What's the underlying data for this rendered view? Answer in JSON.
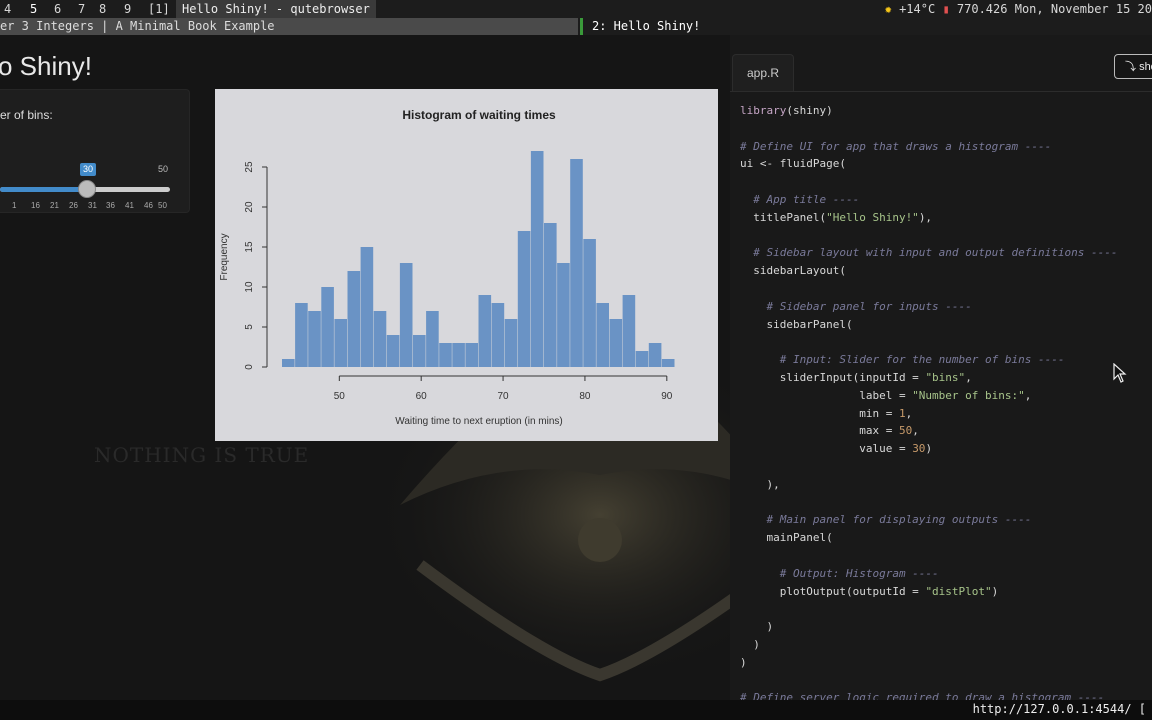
{
  "topbar": {
    "workspaces": [
      {
        "label": "4",
        "sup": "",
        "x": 4
      },
      {
        "label": "5",
        "sup": "",
        "x": 30,
        "active": true
      },
      {
        "label": "6",
        "sup": "",
        "x": 54
      },
      {
        "label": "7",
        "sup": "",
        "x": 78
      },
      {
        "label": "8",
        "sup": "",
        "x": 99
      },
      {
        "label": "9",
        "sup": "",
        "x": 124
      }
    ],
    "layout_indicator": "[1]",
    "window_title": "Hello Shiny! - qutebrowser",
    "weather": "+14°C",
    "battery": "770.426",
    "datetime": "Mon, November 15 20"
  },
  "tabs": {
    "tab1": "er 3 Integers | A Minimal Book Example",
    "tab2": "2: Hello Shiny!"
  },
  "app": {
    "title": "o Shiny!",
    "slider": {
      "label": "er of bins:",
      "value": "30",
      "max_label": "50",
      "ticks": [
        "1",
        "16",
        "21",
        "26",
        "31",
        "36",
        "41",
        "46",
        "50"
      ]
    },
    "watermark": "NOTHING IS TRUE"
  },
  "plot": {
    "title": "Histogram of waiting times",
    "xlabel": "Waiting time to next eruption (in mins)",
    "ylabel": "Frequency"
  },
  "chart_data": {
    "type": "bar",
    "title": "Histogram of waiting times",
    "xlabel": "Waiting time to next eruption (in mins)",
    "ylabel": "Frequency",
    "bin_width": 1.6,
    "x_start": 43,
    "values": [
      1,
      8,
      7,
      10,
      6,
      12,
      15,
      7,
      4,
      13,
      4,
      7,
      3,
      3,
      3,
      9,
      8,
      6,
      17,
      27,
      18,
      13,
      26,
      16,
      8,
      6,
      9,
      2,
      3,
      1
    ],
    "xticks": [
      50,
      60,
      70,
      80,
      90
    ],
    "yticks": [
      0,
      5,
      10,
      15,
      20,
      25
    ],
    "xlim": [
      43,
      91
    ],
    "ylim": [
      0,
      27
    ],
    "bar_color": "#6a93c5"
  },
  "code_panel": {
    "tab_label": "app.R",
    "show_button": "show",
    "lines": [
      [
        [
          "fn",
          "library"
        ],
        [
          "",
          "("
        ],
        [
          "",
          "shiny"
        ],
        [
          "",
          ")"
        ]
      ],
      [],
      [
        [
          "cm",
          "# Define UI for app that draws a histogram ----"
        ]
      ],
      [
        [
          "",
          "ui <- fluidPage("
        ]
      ],
      [],
      [
        [
          "cm",
          "  # App title ----"
        ]
      ],
      [
        [
          "",
          "  titlePanel("
        ],
        [
          "st",
          "\"Hello Shiny!\""
        ],
        [
          "",
          "),"
        ]
      ],
      [],
      [
        [
          "cm",
          "  # Sidebar layout with input and output definitions ----"
        ]
      ],
      [
        [
          "",
          "  sidebarLayout("
        ]
      ],
      [],
      [
        [
          "cm",
          "    # Sidebar panel for inputs ----"
        ]
      ],
      [
        [
          "",
          "    sidebarPanel("
        ]
      ],
      [],
      [
        [
          "cm",
          "      # Input: Slider for the number of bins ----"
        ]
      ],
      [
        [
          "",
          "      sliderInput(inputId = "
        ],
        [
          "st",
          "\"bins\""
        ],
        [
          "",
          ","
        ]
      ],
      [
        [
          "",
          "                  label = "
        ],
        [
          "st",
          "\"Number of bins:\""
        ],
        [
          "",
          ","
        ]
      ],
      [
        [
          "",
          "                  min = "
        ],
        [
          "nm",
          "1"
        ],
        [
          "",
          ","
        ]
      ],
      [
        [
          "",
          "                  max = "
        ],
        [
          "nm",
          "50"
        ],
        [
          "",
          ","
        ]
      ],
      [
        [
          "",
          "                  value = "
        ],
        [
          "nm",
          "30"
        ],
        [
          "",
          ")"
        ]
      ],
      [],
      [
        [
          "",
          "    ),"
        ]
      ],
      [],
      [
        [
          "cm",
          "    # Main panel for displaying outputs ----"
        ]
      ],
      [
        [
          "",
          "    mainPanel("
        ]
      ],
      [],
      [
        [
          "cm",
          "      # Output: Histogram ----"
        ]
      ],
      [
        [
          "",
          "      plotOutput(outputId = "
        ],
        [
          "st",
          "\"distPlot\""
        ],
        [
          "",
          ")"
        ]
      ],
      [],
      [
        [
          "",
          "    )"
        ]
      ],
      [
        [
          "",
          "  )"
        ]
      ],
      [
        [
          "",
          ")"
        ]
      ],
      [],
      [
        [
          "cm",
          "# Define server logic required to draw a histogram ----"
        ]
      ]
    ]
  },
  "statusbar": {
    "url": "http://127.0.0.1:4544/ ["
  }
}
